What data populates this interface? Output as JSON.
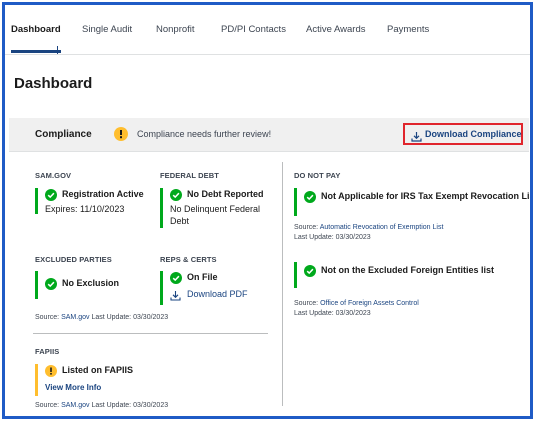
{
  "tabs": [
    {
      "label": "Dashboard"
    },
    {
      "label": "Single Audit"
    },
    {
      "label": "Nonprofit"
    },
    {
      "label": "PD/PI Contacts"
    },
    {
      "label": "Active Awards"
    },
    {
      "label": "Payments"
    }
  ],
  "page_title": "Dashboard",
  "compliance": {
    "label": "Compliance",
    "message": "Compliance needs further review!",
    "download_label": "Download Compliance"
  },
  "sam_gov": {
    "heading": "SAM.GOV",
    "title": "Registration Active",
    "sub": "Expires: 11/10/2023"
  },
  "federal_debt": {
    "heading": "FEDERAL DEBT",
    "title": "No Debt Reported",
    "sub1": "No Delinquent Federal",
    "sub2": "Debt"
  },
  "excluded_parties": {
    "heading": "EXCLUDED PARTIES",
    "title": "No Exclusion"
  },
  "reps_certs": {
    "heading": "REPS & CERTS",
    "title": "On File",
    "link": "Download PDF"
  },
  "left_footer": {
    "source_label": "Source:",
    "source_link": "SAM.gov",
    "update": "Last Update: 03/30/2023"
  },
  "fapiis": {
    "heading": "FAPIIS",
    "title": "Listed on FAPIIS",
    "link": "View More Info",
    "source_label": "Source:",
    "source_link": "SAM.gov",
    "update": "Last Update: 03/30/2023"
  },
  "do_not_pay": {
    "heading": "DO NOT PAY",
    "item1": {
      "title": "Not Applicable for IRS Tax Exempt Revocation List",
      "source_label": "Source:",
      "source_link": "Automatic Revocation of Exemption List",
      "update": "Last Update: 03/30/2023"
    },
    "item2": {
      "title": "Not on the Excluded Foreign Entities list",
      "source_label": "Source:",
      "source_link": "Office of Foreign Assets Control",
      "update": "Last Update: 03/30/2023"
    }
  },
  "colors": {
    "accent": "#1a4480",
    "success": "#00a91c",
    "warning": "#ffbe2e",
    "highlight_border": "#e0252c",
    "frame_border": "#1f5bc6"
  },
  "icons": {
    "check": "check-circle-icon",
    "warning": "warning-circle-icon",
    "download": "download-icon"
  }
}
